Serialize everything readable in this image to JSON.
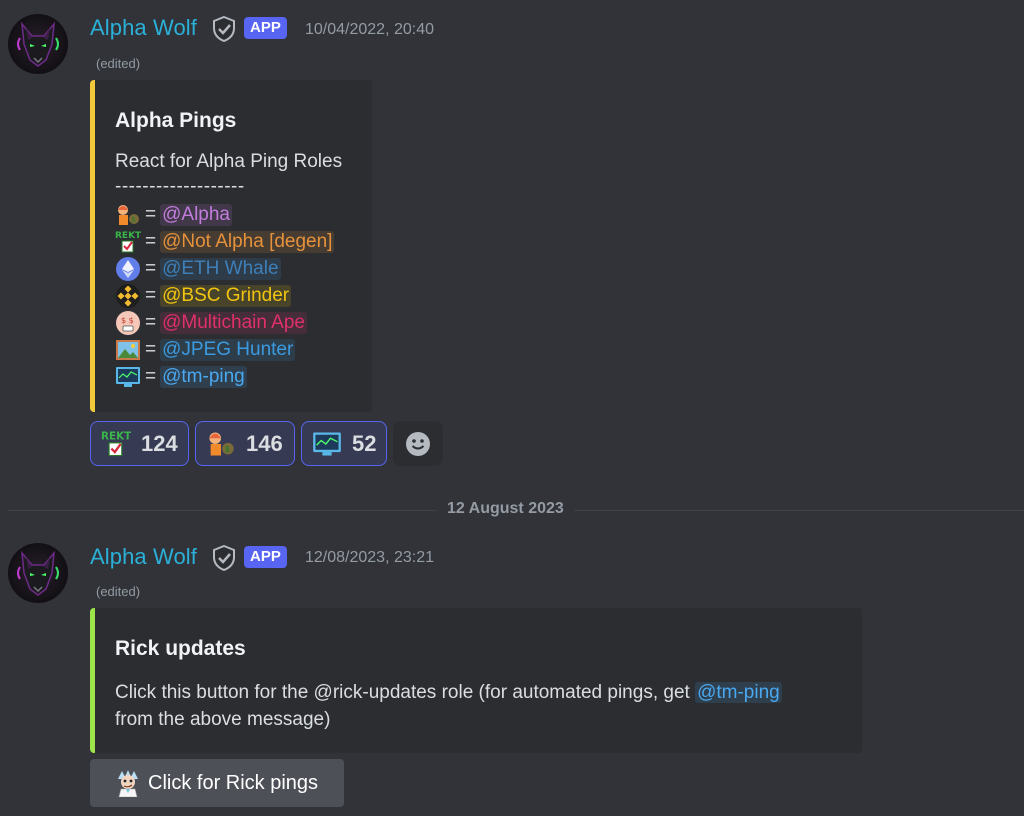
{
  "messages": [
    {
      "author": "Alpha Wolf",
      "badge": "APP",
      "timestamp": "10/04/2022, 20:40",
      "edited": "(edited)",
      "embed": {
        "accent_color": "#f0c83a",
        "title": "Alpha Pings",
        "description_line1": "React for Alpha Ping Roles",
        "description_line2": "-------------------",
        "roles": [
          {
            "emoji": "guy-with-money-bag-icon",
            "eq": "=",
            "mention": "@Alpha",
            "color": "#c27cdc"
          },
          {
            "emoji": "rekt-check-icon",
            "eq": "=",
            "mention": "@Not Alpha [degen]",
            "color": "#e6913b"
          },
          {
            "emoji": "ethereum-icon",
            "eq": "=",
            "mention": "@ETH Whale",
            "color": "#3f7fb8"
          },
          {
            "emoji": "bnb-icon",
            "eq": "=",
            "mention": "@BSC Grinder",
            "color": "#f1c40f"
          },
          {
            "emoji": "money-face-icon",
            "eq": "=",
            "mention": "@Multichain Ape",
            "color": "#e0306a"
          },
          {
            "emoji": "picture-frame-icon",
            "eq": "=",
            "mention": "@JPEG Hunter",
            "color": "#3b9be0"
          },
          {
            "emoji": "monitor-chart-icon",
            "eq": "=",
            "mention": "@tm-ping",
            "color": "#4aa8f0"
          }
        ]
      },
      "reactions": [
        {
          "emoji": "rekt-check-icon",
          "count": "124"
        },
        {
          "emoji": "guy-with-money-bag-icon",
          "count": "146"
        },
        {
          "emoji": "monitor-chart-icon",
          "count": "52"
        }
      ]
    },
    {
      "author": "Alpha Wolf",
      "badge": "APP",
      "timestamp": "12/08/2023, 23:21",
      "edited": "(edited)",
      "embed": {
        "accent_color": "#9de34a",
        "title": "Rick updates",
        "description_part1": "Click this button for the @rick-updates role (for automated pings, get ",
        "mention": "@tm-ping",
        "description_part2": "from the above message)"
      },
      "button": {
        "label": "Click for Rick pings",
        "emoji": "rick-scientist-icon"
      }
    }
  ],
  "date_divider": "12 August 2023"
}
